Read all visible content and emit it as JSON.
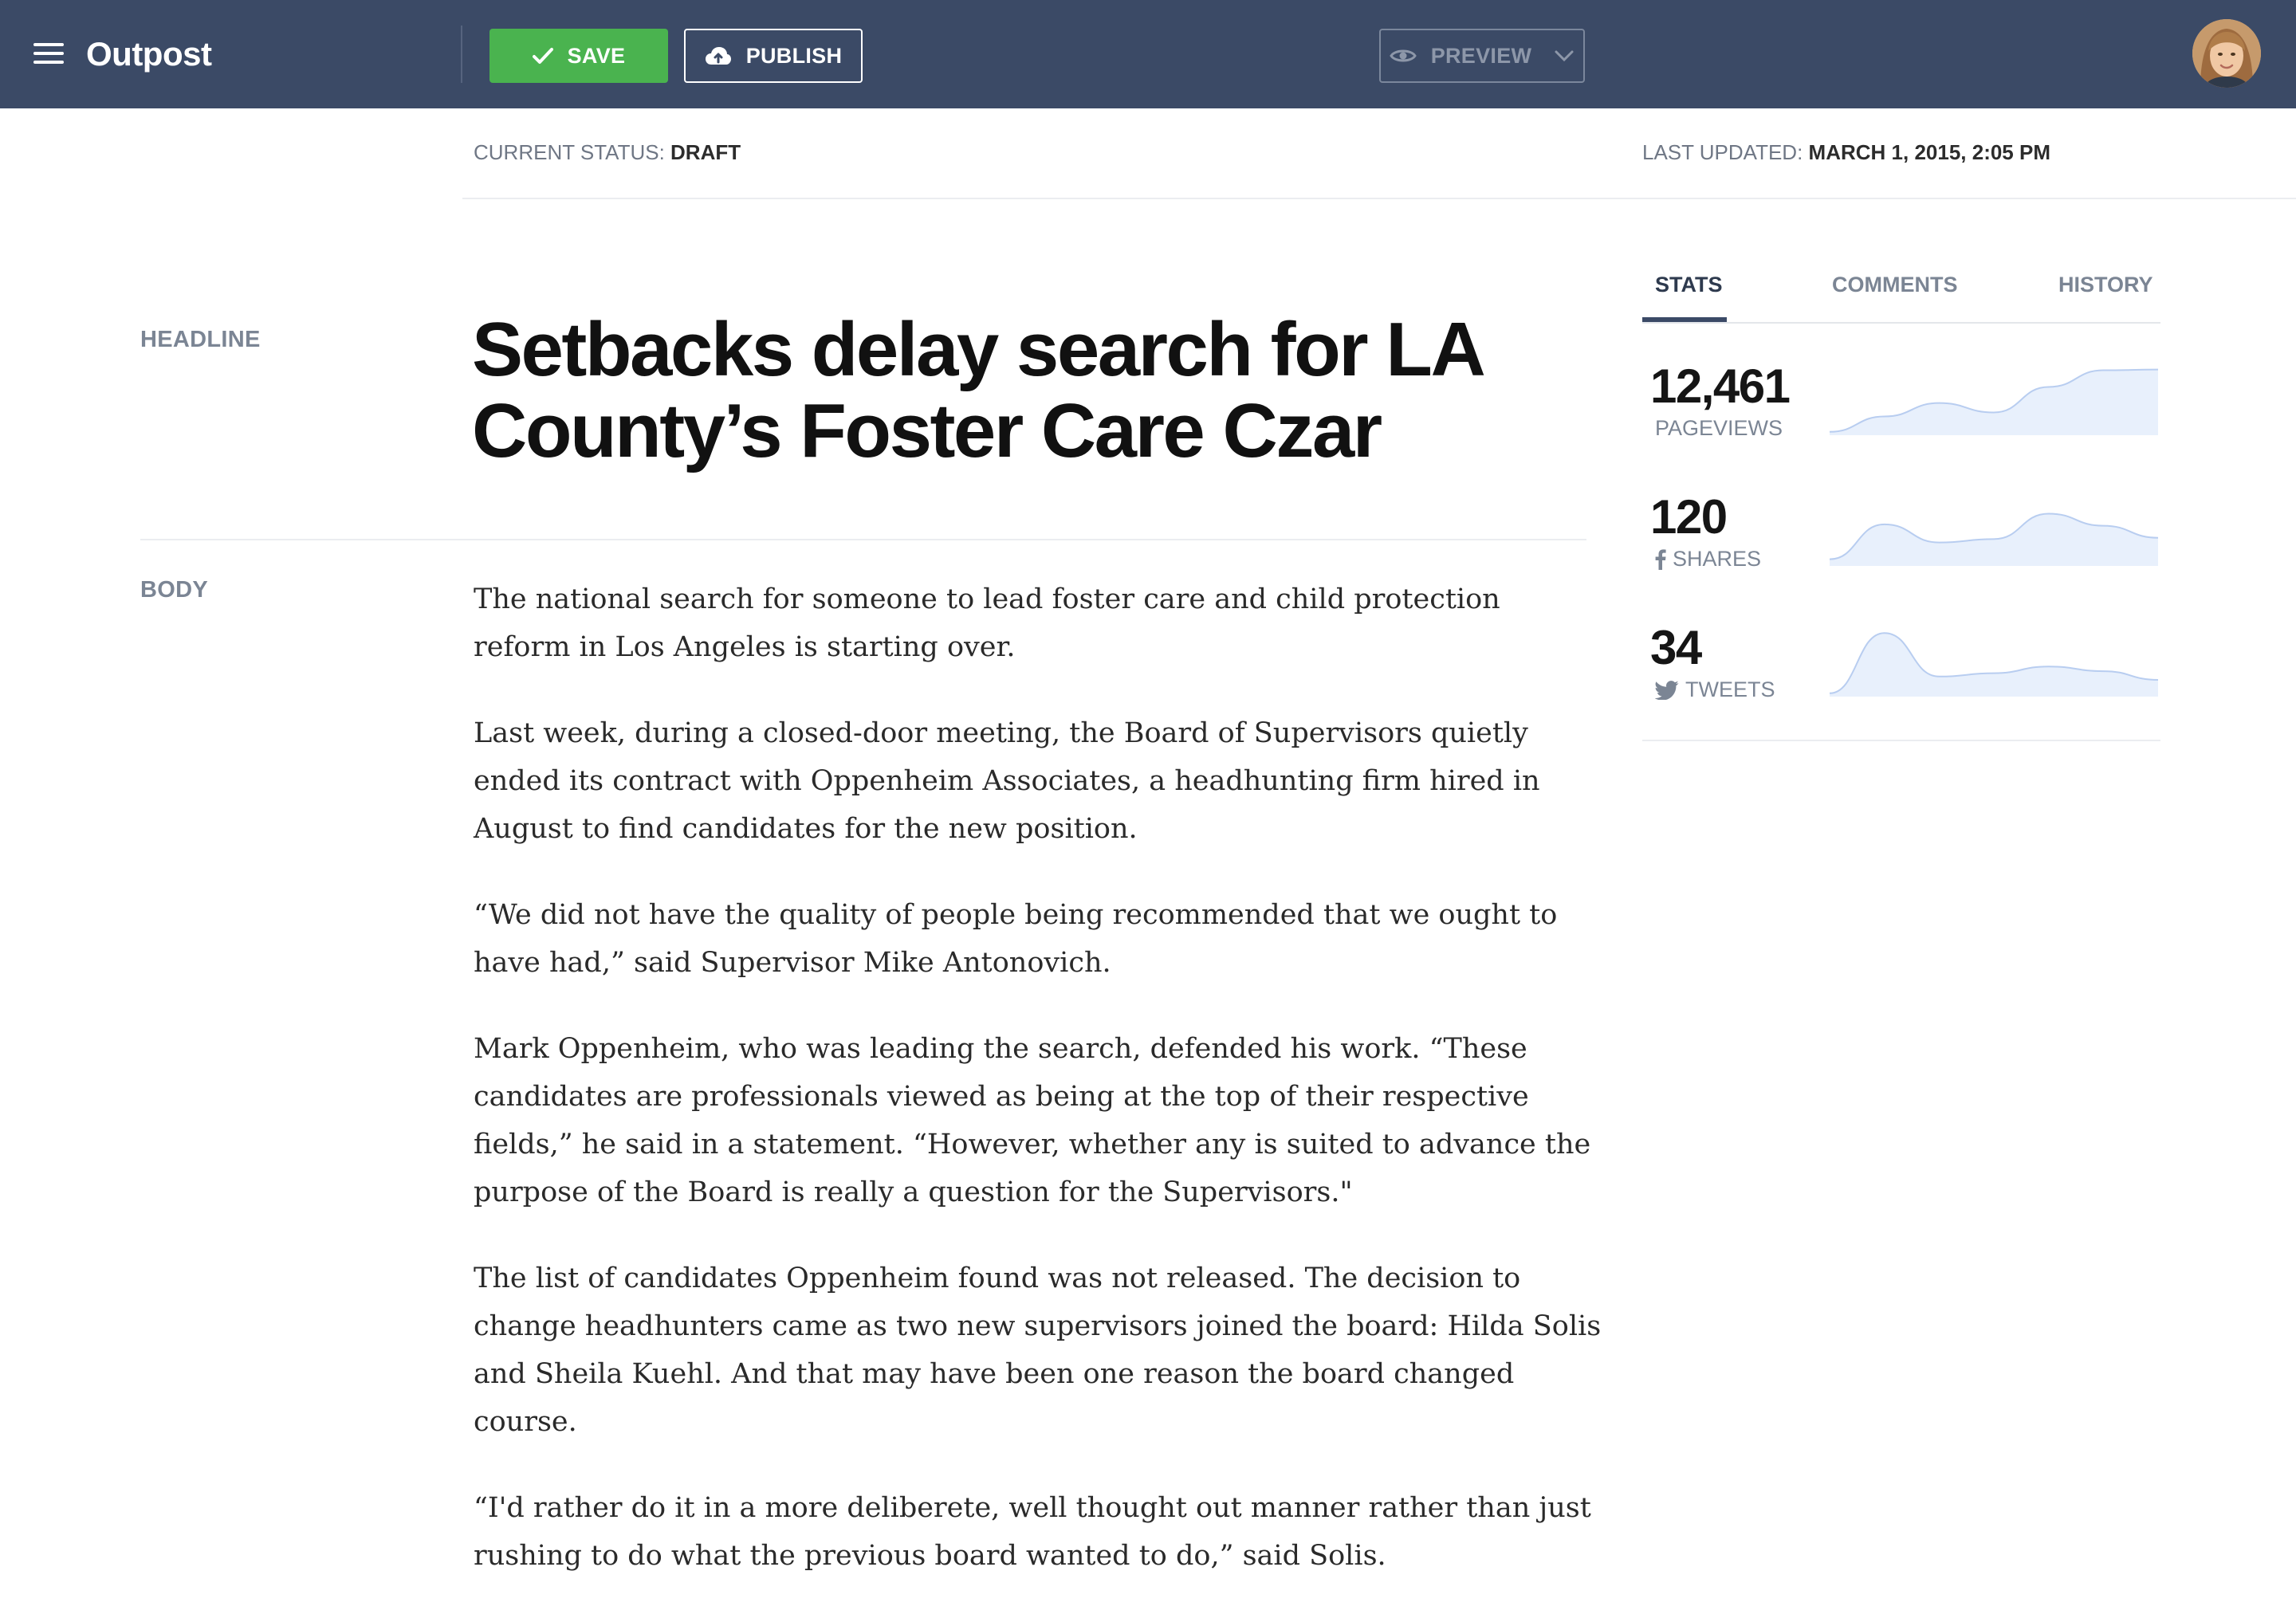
{
  "app": {
    "name": "Outpost"
  },
  "toolbar": {
    "save_label": "SAVE",
    "publish_label": "PUBLISH",
    "preview_label": "PREVIEW"
  },
  "status": {
    "current_label": "CURRENT STATUS:",
    "current_value": "DRAFT",
    "updated_label": "LAST UPDATED:",
    "updated_value": "MARCH 1, 2015, 2:05 PM"
  },
  "labels": {
    "headline": "HEADLINE",
    "body": "BODY"
  },
  "article": {
    "headline_line1": "Setbacks delay search for LA",
    "headline_line2": "County’s Foster Care Czar",
    "paragraphs": [
      "The national search for someone to lead foster care and child protection reform in Los Angeles is starting over.",
      "Last week, during a closed-door meeting, the Board of Supervisors quietly ended its contract with Oppenheim Associates, a headhunting firm hired in August to find candidates for the new position.",
      "“We did not have the quality of people being recommended that we ought to have had,” said Supervisor Mike Antonovich.",
      "Mark Oppenheim, who was leading the search, defended his work. “These candidates are professionals viewed as being at the top of their respective fields,” he said in a statement. “However, whether any is suited to advance the purpose of the Board is really a question for the Supervisors.\"",
      "The list of candidates Oppenheim found was not released. The decision to change headhunters came as two new supervisors joined the board: Hilda Solis and Sheila Kuehl. And that may have been one reason the board changed course.",
      "“I'd rather do it in a more deliberete, well thought out manner rather than just rushing to do what the previous board wanted to do,” said Solis."
    ]
  },
  "sidebar": {
    "tabs": [
      {
        "label": "STATS",
        "active": true
      },
      {
        "label": "COMMENTS",
        "active": false
      },
      {
        "label": "HISTORY",
        "active": false
      }
    ],
    "stats": [
      {
        "value": "12,461",
        "label": "PAGEVIEWS",
        "icon": "none",
        "trend": [
          0.05,
          0.28,
          0.48,
          0.34,
          0.72,
          0.97,
          0.98
        ]
      },
      {
        "value": "120",
        "label": "SHARES",
        "icon": "facebook-icon",
        "trend": [
          0.1,
          0.62,
          0.35,
          0.4,
          0.78,
          0.6,
          0.42
        ]
      },
      {
        "value": "34",
        "label": "TWEETS",
        "icon": "twitter-icon",
        "trend": [
          0.05,
          0.95,
          0.3,
          0.35,
          0.45,
          0.38,
          0.25
        ]
      }
    ]
  },
  "colors": {
    "topbar": "#3b4a66",
    "save": "#4ab34f",
    "spark_fill": "#e8f0fc",
    "spark_line": "#b8cdf0"
  }
}
